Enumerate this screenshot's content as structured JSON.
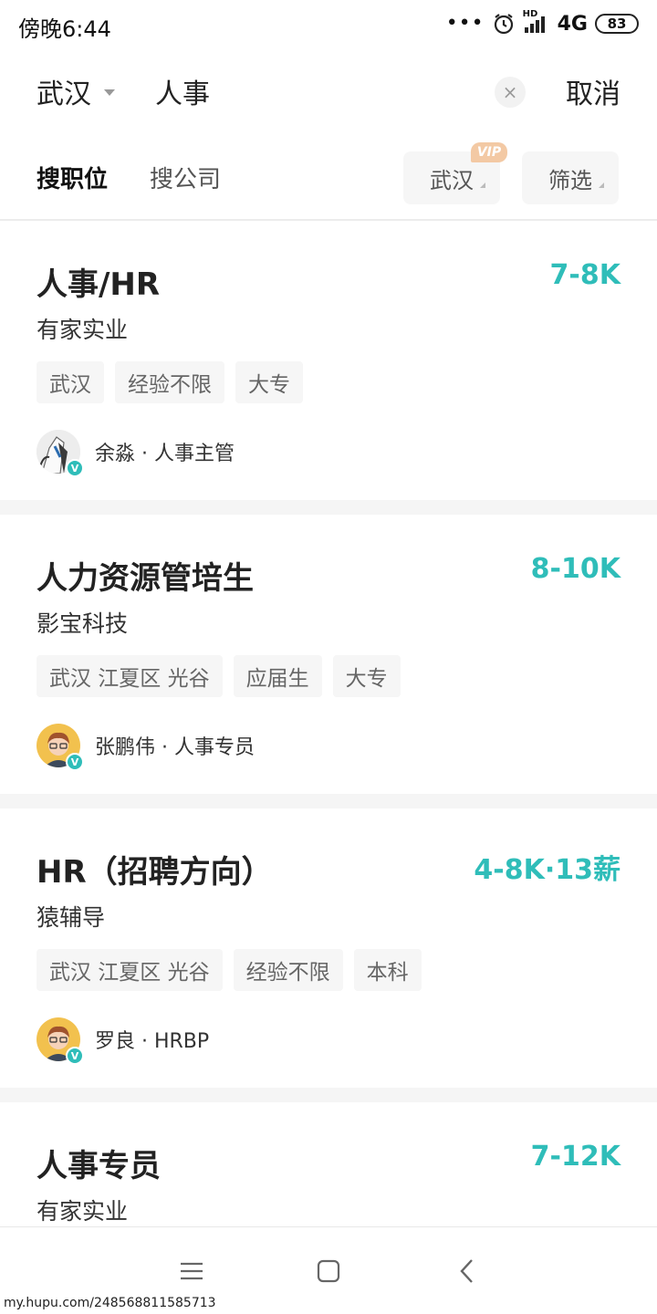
{
  "status_bar": {
    "time": "傍晚6:44",
    "network": "4G",
    "signal_badge": "HD",
    "battery": "83"
  },
  "search": {
    "city": "武汉",
    "query": "人事",
    "clear_label": "×",
    "cancel_label": "取消"
  },
  "tabs": {
    "active": "搜职位",
    "other": "搜公司"
  },
  "filters": {
    "city": "武汉",
    "vip_badge": "VIP",
    "screen": "筛选"
  },
  "jobs": [
    {
      "title": "人事/HR",
      "salary": "7-8K",
      "company": "有家实业",
      "tags": [
        "武汉",
        "经验不限",
        "大专"
      ],
      "recruiter": "余淼 · 人事主管",
      "verified": "V"
    },
    {
      "title": "人力资源管培生",
      "salary": "8-10K",
      "company": "影宝科技",
      "tags": [
        "武汉 江夏区 光谷",
        "应届生",
        "大专"
      ],
      "recruiter": "张鹏伟 · 人事专员",
      "verified": "V"
    },
    {
      "title": "HR（招聘方向）",
      "salary": "4-8K·13薪",
      "company": "猿辅导",
      "tags": [
        "武汉 江夏区 光谷",
        "经验不限",
        "本科"
      ],
      "recruiter": "罗良 · HRBP",
      "verified": "V"
    },
    {
      "title": "人事专员",
      "salary": "7-12K",
      "company": "有家实业"
    }
  ],
  "watermark": "my.hupu.com/248568811585713",
  "colors": {
    "salary": "#2fbdb9",
    "vip": "#f3c9a4",
    "tag_bg": "#f6f6f6"
  },
  "icons": {
    "alarm": "alarm-icon",
    "signal": "signal-icon",
    "clear": "clear-icon",
    "menu": "menu-icon",
    "home": "home-icon",
    "back": "back-icon"
  }
}
